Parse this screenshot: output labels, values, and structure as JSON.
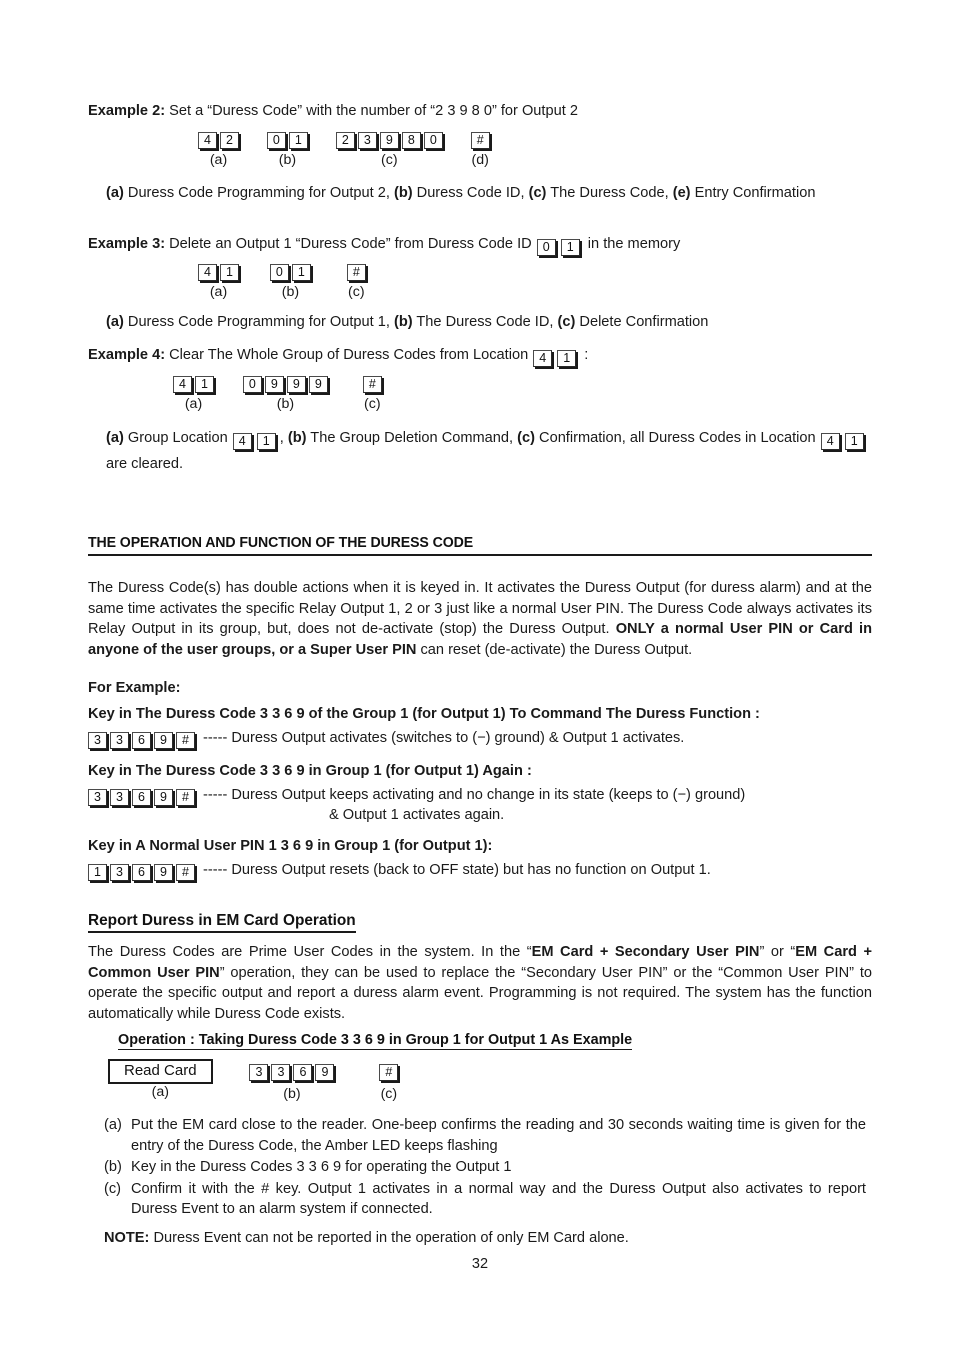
{
  "document": {
    "page_number": "32"
  },
  "example2": {
    "label": "Example 2:",
    "text": " Set a “Duress Code” with the number of “2 3 9 8 0” for Output 2",
    "groups": [
      {
        "keys": [
          "4",
          "2"
        ],
        "cap": "(a)"
      },
      {
        "keys": [
          "0",
          "1"
        ],
        "cap": "(b)"
      },
      {
        "keys": [
          "2",
          "3",
          "9",
          "8",
          "0"
        ],
        "cap": "(c)"
      },
      {
        "keys": [
          "#"
        ],
        "cap": "(d)"
      }
    ],
    "legend": [
      {
        "tag": "(a)",
        "text": " Duress Code Programming for Output 2, "
      },
      {
        "tag": "(b)",
        "text": " Duress Code ID, "
      },
      {
        "tag": "(c)",
        "text": " The Duress Code, "
      },
      {
        "tag": "(e)",
        "text": " Entry Confirmation"
      }
    ]
  },
  "example3": {
    "label": "Example 3:",
    "text_before": " Delete an Output 1 “Duress Code” from Duress Code ID ",
    "inline_keys": [
      "0",
      "1"
    ],
    "text_after": " in the memory",
    "groups": [
      {
        "keys": [
          "4",
          "1"
        ],
        "cap": "(a)"
      },
      {
        "keys": [
          "0",
          "1"
        ],
        "cap": "(b)"
      },
      {
        "keys": [
          "#"
        ],
        "cap": "(c)"
      }
    ],
    "legend": [
      {
        "tag": "(a)",
        "text": " Duress Code Programming for Output 1, "
      },
      {
        "tag": "(b)",
        "text": " The Duress Code ID, "
      },
      {
        "tag": "(c)",
        "text": " Delete Confirmation"
      }
    ]
  },
  "example4": {
    "label": "Example 4:",
    "text_before": " Clear The Whole Group of Duress Codes from Location ",
    "inline_keys": [
      "4",
      "1"
    ],
    "text_after": " :",
    "groups": [
      {
        "keys": [
          "4",
          "1"
        ],
        "cap": "(a)"
      },
      {
        "keys": [
          "0",
          "9",
          "9",
          "9"
        ],
        "cap": "(b)"
      },
      {
        "keys": [
          "#"
        ],
        "cap": "(c)"
      }
    ],
    "legend_a_tag": "(a)",
    "legend_a_text": " Group Location ",
    "legend_a_keys": [
      "4",
      "1"
    ],
    "legend_b_tag": "(b)",
    "legend_b_text": " The Group Deletion Command, ",
    "legend_c_tag": "(c)",
    "legend_c_text": " Confirmation, all Duress Codes in Location ",
    "legend_c_keys": [
      "4",
      "1"
    ],
    "legend_c_tail": " are cleared."
  },
  "section": {
    "heading": "THE OPERATION AND FUNCTION OF THE DURESS CODE",
    "para_part1": "The Duress Code(s) has double actions when it is keyed in. It activates the Duress Output (for duress alarm) and at the same time activates the specific Relay Output 1, 2 or 3 just like a normal User PIN. The Duress Code always activates its Relay Output in its group, but, does not de-activate (stop) the Duress Output. ",
    "para_bold": "ONLY a normal User PIN or Card in anyone of the user groups, or a Super User PIN",
    "para_part2": " can reset (de-activate) the Duress Output.",
    "for_example": "For Example:"
  },
  "duress_examples": [
    {
      "heading": "Key in The Duress Code 3 3 6 9 of the Group 1 (for Output 1) To Command The Duress Function :",
      "keys": [
        "3",
        "3",
        "6",
        "9",
        "#"
      ],
      "result": "----- Duress Output activates (switches to (−) ground) & Output 1 activates.",
      "result_line2": ""
    },
    {
      "heading": "Key in The Duress Code 3 3 6 9 in Group 1 (for Output 1) Again :",
      "keys": [
        "3",
        "3",
        "6",
        "9",
        "#"
      ],
      "result": "----- Duress Output keeps activating and no change in its state (keeps to (−) ground)",
      "result_line2": "& Output 1 activates again."
    },
    {
      "heading": "Key in A Normal User PIN 1 3 6 9 in Group 1 (for Output 1):",
      "keys": [
        "1",
        "3",
        "6",
        "9",
        "#"
      ],
      "result": "----- Duress Output resets (back to OFF state) but has no function on Output 1.",
      "result_line2": ""
    }
  ],
  "em_card": {
    "heading": "Report Duress in EM Card Operation",
    "para_1": "The Duress Codes are Prime User Codes in the system. In the “",
    "para_bold_1": "EM Card + Secondary User PIN",
    "para_2": "” or “",
    "para_bold_2": "EM Card + Common User PIN",
    "para_3": "” operation, they can be used to replace the “Secondary User PIN” or the “Common User PIN” to operate the specific output and report a duress alarm event. Programming is not required. The system has the function automatically while Duress Code exists.",
    "operation_heading": "Operation : Taking Duress Code 3 3 6 9 in Group 1 for Output 1 As Example",
    "read_card_label": "Read Card",
    "groups": [
      {
        "keys": [],
        "cap": "(a)"
      },
      {
        "keys": [
          "3",
          "3",
          "6",
          "9"
        ],
        "cap": "(b)"
      },
      {
        "keys": [
          "#"
        ],
        "cap": "(c)"
      }
    ],
    "steps": [
      {
        "mark": "(a)",
        "text": "Put the EM card close to the reader. One-beep confirms the reading and 30 seconds waiting time is given for the entry of the Duress Code, the Amber LED keeps flashing"
      },
      {
        "mark": "(b)",
        "text": "Key in the Duress Codes 3 3 6 9 for operating the Output 1"
      },
      {
        "mark": "(c)",
        "text": "Confirm it with the # key. Output 1 activates in a normal way and the Duress Output also activates to report Duress Event to an alarm system if connected."
      }
    ],
    "note_label": "NOTE:",
    "note_text": " Duress Event can not be reported in the operation of only EM Card alone."
  }
}
